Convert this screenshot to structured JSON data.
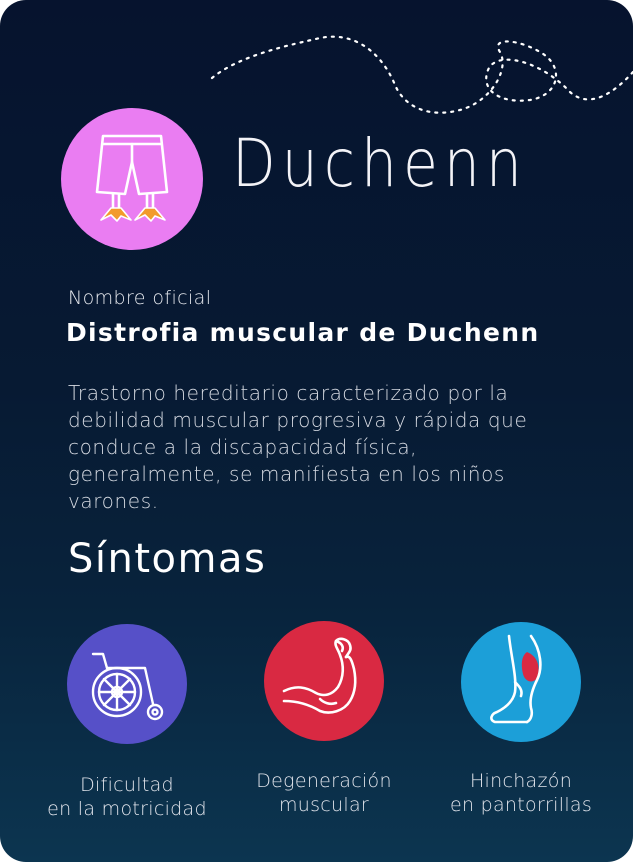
{
  "header": {
    "title": "Duchenn",
    "badge_icon": "shorts-with-duck-feet-icon",
    "badge_color": "#ea7df2"
  },
  "official": {
    "label": "Nombre oficial",
    "name": "Distrofia muscular de Duchenn"
  },
  "description": "Trastorno hereditario caracterizado por la debilidad muscular progresiva y rápida que conduce a la discapacidad física, generalmente, se manifiesta en los niños varones.",
  "symptoms": {
    "heading": "Síntomas",
    "items": [
      {
        "icon": "wheelchair-icon",
        "color": "#5650c8",
        "line1": "Dificultad",
        "line2": "en la motricidad"
      },
      {
        "icon": "flexed-arm-icon",
        "color": "#d92942",
        "line1": "Degeneración",
        "line2": "muscular"
      },
      {
        "icon": "swollen-calf-leg-icon",
        "color": "#1c9fd8",
        "line1": "Hinchazón",
        "line2": "en pantorrillas"
      }
    ]
  },
  "colors": {
    "background_top": "#06132e",
    "background_bottom": "#0c3550",
    "text": "#ffffff"
  }
}
